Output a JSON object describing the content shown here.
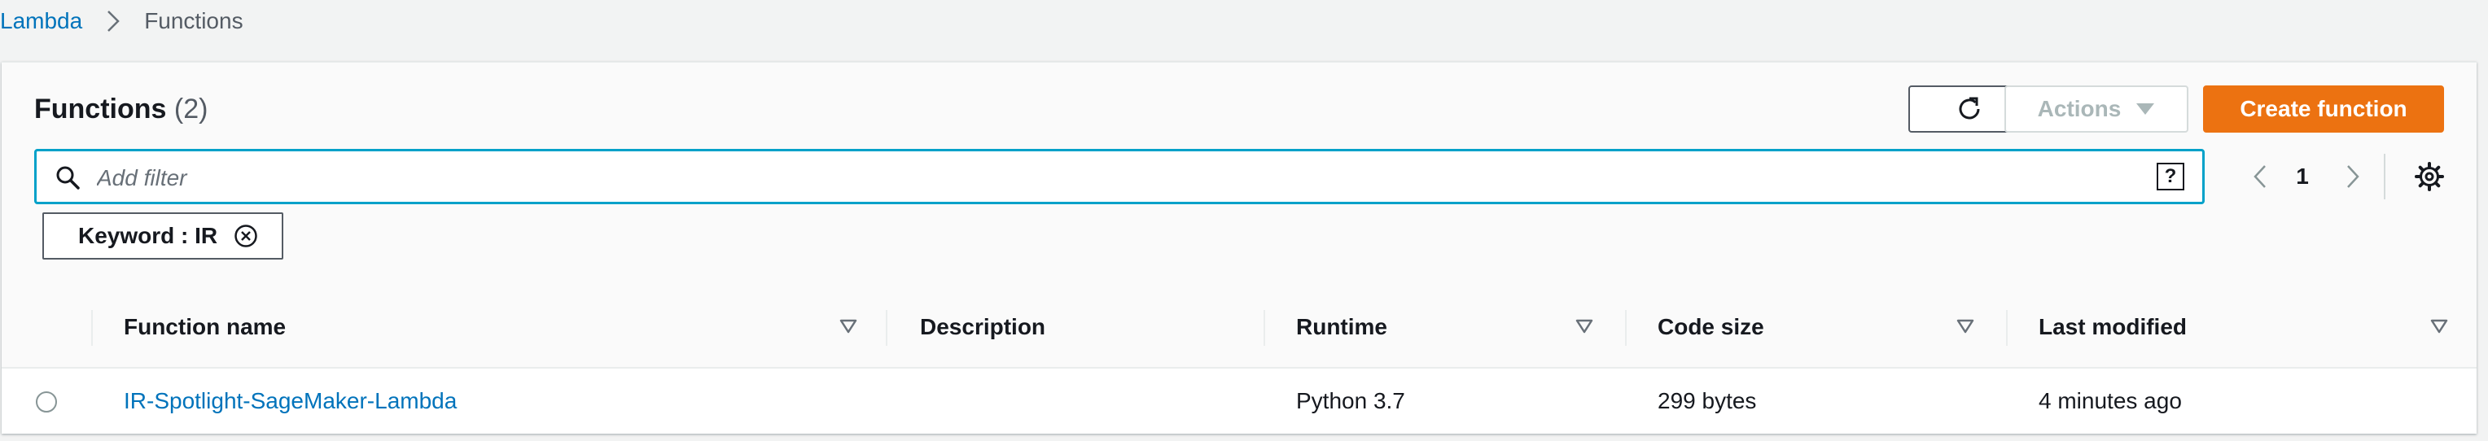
{
  "breadcrumb": {
    "root": "Lambda",
    "current": "Functions"
  },
  "header": {
    "title": "Functions",
    "count": "(2)"
  },
  "toolbar": {
    "actions_label": "Actions",
    "create_label": "Create function"
  },
  "filter": {
    "placeholder": "Add filter",
    "help_glyph": "?",
    "token": "Keyword : IR"
  },
  "pagination": {
    "page": "1"
  },
  "table": {
    "columns": [
      "Function name",
      "Description",
      "Runtime",
      "Code size",
      "Last modified"
    ],
    "rows": [
      {
        "function_name": "IR-Spotlight-SageMaker-Lambda",
        "description": "",
        "runtime": "Python 3.7",
        "code_size": "299 bytes",
        "last_modified": "4 minutes ago"
      }
    ]
  },
  "colors": {
    "link": "#0073bb",
    "primary": "#ec7211",
    "focus": "#00a1c9"
  },
  "icons": [
    "chevron-right-icon",
    "refresh-icon",
    "caret-down-icon",
    "search-icon",
    "help-icon",
    "chevron-left-icon",
    "gear-icon",
    "clear-icon",
    "sort-icon"
  ]
}
